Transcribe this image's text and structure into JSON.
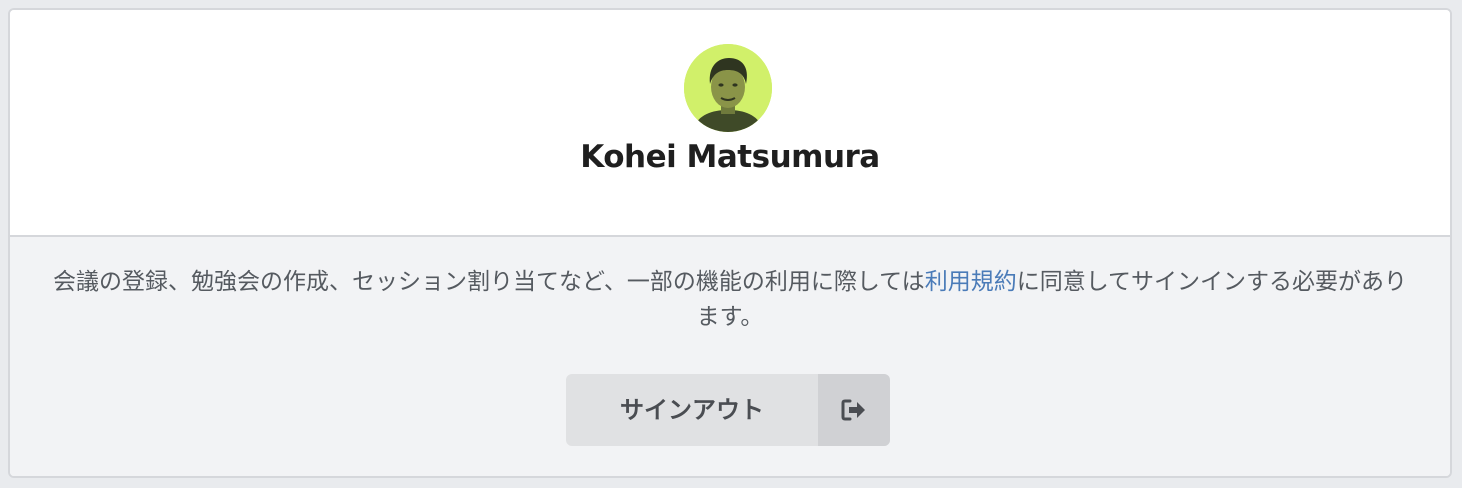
{
  "profile": {
    "name": "Kohei Matsumura",
    "avatar_icon": "user-photo"
  },
  "notice": {
    "text_before": "会議の登録、勉強会の作成、セッション割り当てなど、一部の機能の利用に際しては",
    "link_text": "利用規約",
    "text_after": "に同意してサインインする必要があります。"
  },
  "signout_button": {
    "label": "サインアウト",
    "icon": "sign-out-icon"
  },
  "colors": {
    "link": "#4a7bb8",
    "avatar_background": "#d1f06a",
    "panel_background": "#f2f3f5",
    "button_background": "#e0e1e3"
  }
}
